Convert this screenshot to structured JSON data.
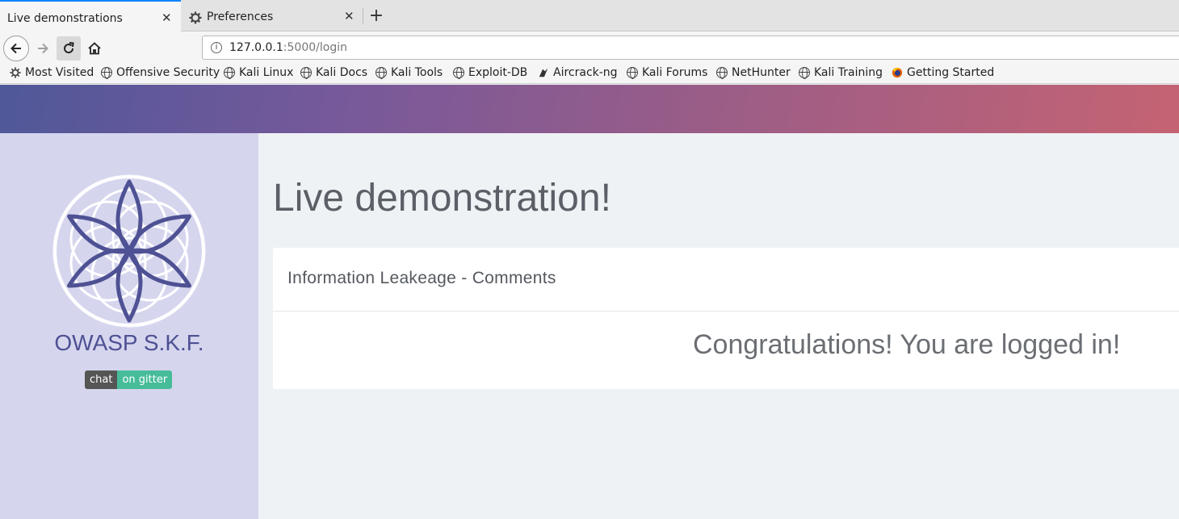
{
  "browser": {
    "tabs": [
      {
        "title": "Live demonstrations",
        "active": true
      },
      {
        "title": "Preferences",
        "active": false,
        "icon": "gear-icon"
      }
    ],
    "new_tab_symbol": "+",
    "close_symbol": "✕",
    "url": {
      "host": "127.0.0.1",
      "path": ":5000/login"
    },
    "bookmarks": [
      {
        "label": "Most Visited",
        "icon": "gear-icon"
      },
      {
        "label": "Offensive Security",
        "icon": "globe-icon"
      },
      {
        "label": "Kali Linux",
        "icon": "globe-icon"
      },
      {
        "label": "Kali Docs",
        "icon": "globe-icon"
      },
      {
        "label": "Kali Tools",
        "icon": "globe-icon"
      },
      {
        "label": "Exploit-DB",
        "icon": "globe-icon"
      },
      {
        "label": "Aircrack-ng",
        "icon": "aircrack-icon"
      },
      {
        "label": "Kali Forums",
        "icon": "globe-icon"
      },
      {
        "label": "NetHunter",
        "icon": "globe-icon"
      },
      {
        "label": "Kali Training",
        "icon": "globe-icon"
      },
      {
        "label": "Getting Started",
        "icon": "firefox-icon"
      }
    ]
  },
  "sidebar": {
    "brand": "OWASP S.K.F.",
    "badge": {
      "left": "chat",
      "right": "on gitter"
    }
  },
  "main": {
    "title": "Live demonstration!",
    "card": {
      "title": "Information Leakeage - Comments",
      "message": "Congratulations! You are logged in!"
    }
  },
  "colors": {
    "accent": "#0a84ff",
    "brand": "#4e5193",
    "sidebar_bg": "#d5d5ee",
    "gitter_green": "#46bc99"
  }
}
